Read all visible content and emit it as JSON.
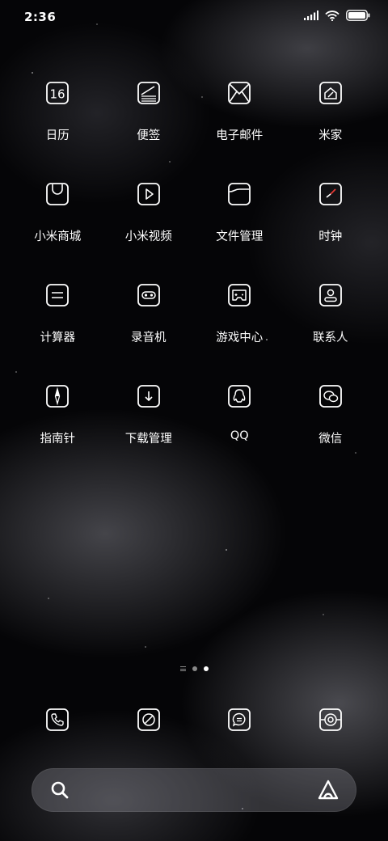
{
  "status_bar": {
    "time": "2:36",
    "icons": [
      "signal-icon",
      "wifi-icon",
      "battery-icon"
    ]
  },
  "calendar_icon_day": "16",
  "apps": [
    {
      "label": "日历",
      "icon": "calendar-icon"
    },
    {
      "label": "便签",
      "icon": "notes-icon"
    },
    {
      "label": "电子邮件",
      "icon": "email-icon"
    },
    {
      "label": "米家",
      "icon": "mijia-icon"
    },
    {
      "label": "小米商城",
      "icon": "mi-store-icon"
    },
    {
      "label": "小米视频",
      "icon": "mi-video-icon"
    },
    {
      "label": "文件管理",
      "icon": "file-manager-icon"
    },
    {
      "label": "时钟",
      "icon": "clock-icon"
    },
    {
      "label": "计算器",
      "icon": "calculator-icon"
    },
    {
      "label": "录音机",
      "icon": "recorder-icon"
    },
    {
      "label": "游戏中心",
      "icon": "game-center-icon"
    },
    {
      "label": "联系人",
      "icon": "contacts-icon"
    },
    {
      "label": "指南针",
      "icon": "compass-icon"
    },
    {
      "label": "下载管理",
      "icon": "download-manager-icon"
    },
    {
      "label": "QQ",
      "icon": "qq-icon"
    },
    {
      "label": "微信",
      "icon": "wechat-icon"
    }
  ],
  "page_indicator": {
    "pages": 2,
    "active": 2
  },
  "dock": [
    {
      "icon": "phone-icon"
    },
    {
      "icon": "browser-icon"
    },
    {
      "icon": "messages-icon"
    },
    {
      "icon": "camera-icon"
    }
  ],
  "search_bar": {
    "left_icon": "search-icon",
    "right_icon": "assistant-icon"
  }
}
